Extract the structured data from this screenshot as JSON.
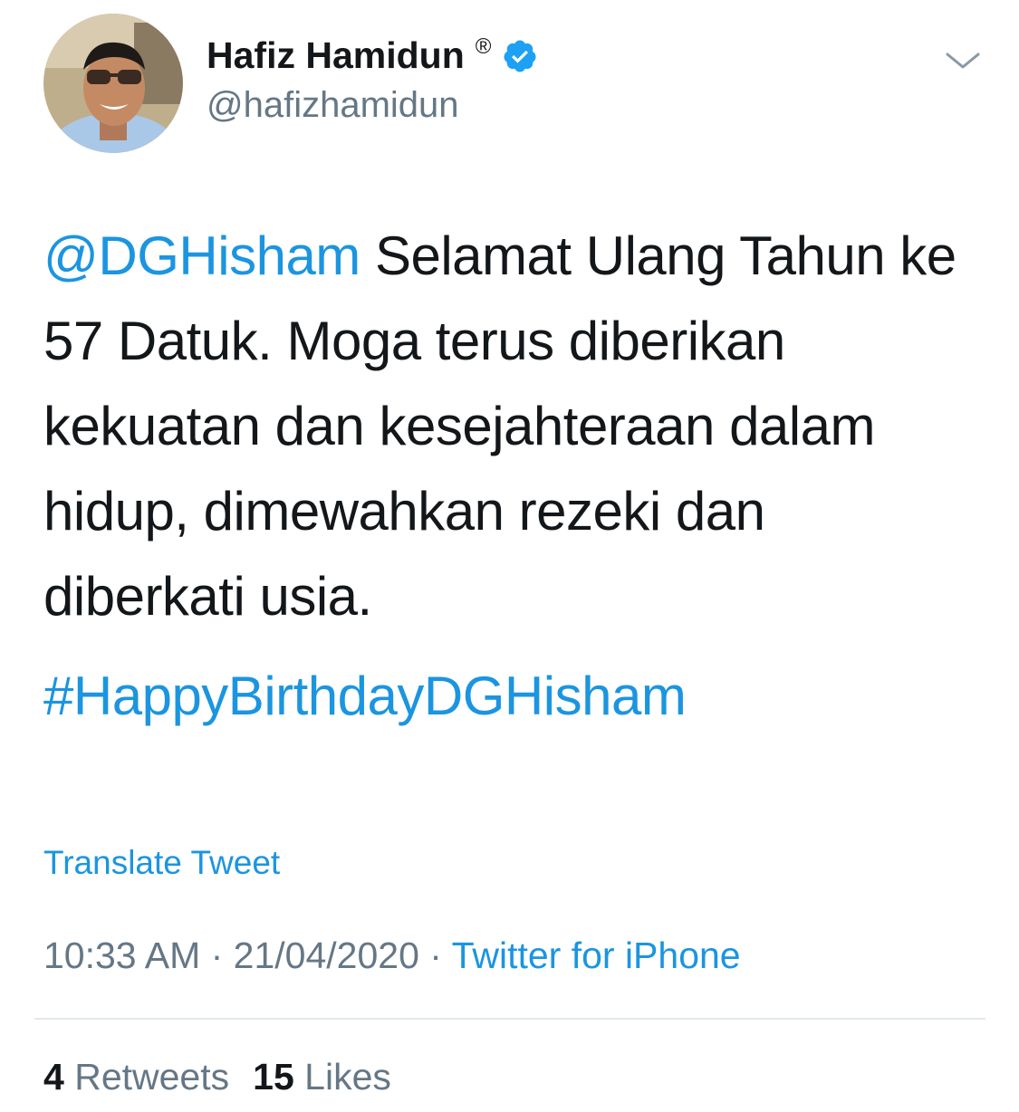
{
  "author": {
    "display_name": "Hafiz Hamidun",
    "registered_mark": "®",
    "handle": "@hafizhamidun",
    "verified_icon": "verified-badge-icon",
    "avatar_icon": "profile-photo"
  },
  "tweet": {
    "mention": "@DGHisham",
    "body": " Selamat Ulang Tahun ke 57 Datuk. Moga terus diberikan kekuatan dan kesejahteraan dalam hidup, dimewahkan rezeki dan diberkati usia.",
    "hashtag": "#HappyBirthdayDGHisham"
  },
  "actions": {
    "translate_label": "Translate Tweet",
    "more_icon": "chevron-down-icon"
  },
  "meta": {
    "time": "10:33 AM",
    "separator": " · ",
    "date": "21/04/2020",
    "source": "Twitter for iPhone"
  },
  "stats": {
    "retweets_count": "4",
    "retweets_label": "Retweets",
    "likes_count": "15",
    "likes_label": "Likes"
  },
  "colors": {
    "link": "#1b95e0",
    "text": "#14171a",
    "muted": "#657786",
    "divider": "#e1e8ed"
  }
}
